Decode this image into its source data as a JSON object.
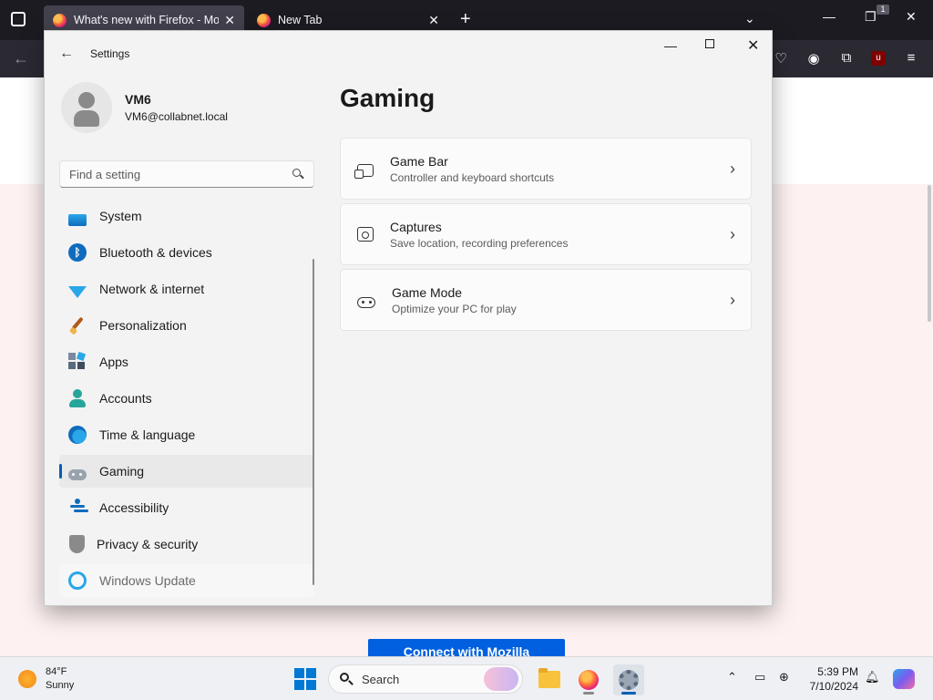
{
  "firefox": {
    "tabs": [
      {
        "title": "What's new with Firefox - More",
        "active": true
      },
      {
        "title": "New Tab",
        "active": false
      }
    ],
    "new_tab_symbol": "+",
    "ublock_badge": "1"
  },
  "webpage": {
    "button_label": "Connect with Mozilla"
  },
  "settings": {
    "window_title": "Settings",
    "user": {
      "name": "VM6",
      "email": "VM6@collabnet.local"
    },
    "search_placeholder": "Find a setting",
    "nav": [
      {
        "label": "System",
        "icon": "system-icon"
      },
      {
        "label": "Bluetooth & devices",
        "icon": "bluetooth-icon"
      },
      {
        "label": "Network & internet",
        "icon": "network-icon"
      },
      {
        "label": "Personalization",
        "icon": "brush-icon"
      },
      {
        "label": "Apps",
        "icon": "apps-icon"
      },
      {
        "label": "Accounts",
        "icon": "account-icon"
      },
      {
        "label": "Time & language",
        "icon": "globe-clock-icon"
      },
      {
        "label": "Gaming",
        "icon": "gamepad-icon",
        "selected": true
      },
      {
        "label": "Accessibility",
        "icon": "accessibility-icon"
      },
      {
        "label": "Privacy & security",
        "icon": "shield-icon"
      },
      {
        "label": "Windows Update",
        "icon": "update-icon"
      }
    ],
    "page_title": "Gaming",
    "cards": [
      {
        "title": "Game Bar",
        "subtitle": "Controller and keyboard shortcuts",
        "icon": "game-bar-icon"
      },
      {
        "title": "Captures",
        "subtitle": "Save location, recording preferences",
        "icon": "capture-icon"
      },
      {
        "title": "Game Mode",
        "subtitle": "Optimize your PC for play",
        "icon": "controller-icon"
      }
    ],
    "accent_color": "#005fb8"
  },
  "taskbar": {
    "weather": {
      "temp": "84°F",
      "condition": "Sunny"
    },
    "search_label": "Search",
    "clock": {
      "time": "5:39 PM",
      "date": "7/10/2024"
    }
  }
}
